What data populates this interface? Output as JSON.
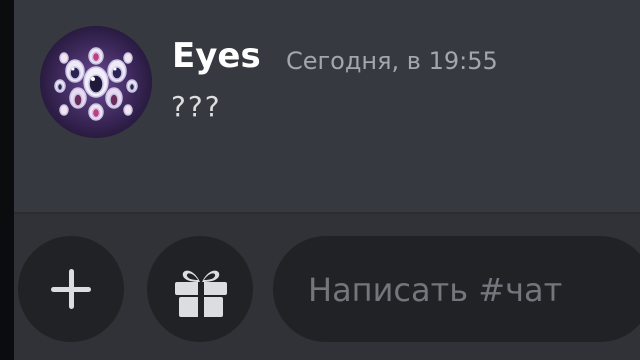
{
  "message": {
    "author": "Eyes",
    "timestamp": "Сегодня, в 19:55",
    "content": "???"
  },
  "composer": {
    "placeholder": "Написать #чат",
    "buttons": [
      {
        "icon": "plus-icon"
      },
      {
        "icon": "gift-icon"
      }
    ]
  },
  "colors": {
    "background": "#36393f",
    "composer_background": "#303238",
    "input_background": "#202225",
    "author": "#ffffff",
    "timestamp": "#a3a6aa",
    "content": "#dcddde",
    "placeholder": "#72767d"
  }
}
